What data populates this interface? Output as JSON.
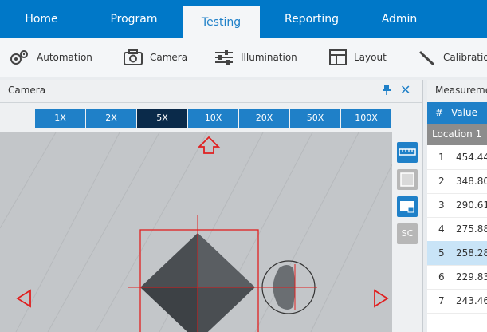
{
  "menu": {
    "tabs": [
      "Home",
      "Program",
      "Testing",
      "Reporting",
      "Admin"
    ],
    "active": "Testing"
  },
  "toolbar": {
    "items": [
      {
        "label": "Automation",
        "icon": "gears-icon"
      },
      {
        "label": "Camera",
        "icon": "camera-icon"
      },
      {
        "label": "Illumination",
        "icon": "sliders-icon"
      },
      {
        "label": "Layout",
        "icon": "layout-icon"
      },
      {
        "label": "Calibratio",
        "icon": "wrench-icon"
      }
    ]
  },
  "camera_panel": {
    "title": "Camera",
    "zoom_levels": [
      "1X",
      "2X",
      "5X",
      "10X",
      "20X",
      "50X",
      "100X"
    ],
    "active_zoom": "5X",
    "side_tools": [
      {
        "icon": "ruler-icon"
      },
      {
        "icon": "crop-icon"
      },
      {
        "icon": "monitor-icon"
      },
      {
        "icon": "sc-button",
        "label": "SC"
      }
    ]
  },
  "measurement_panel": {
    "title": "Measureme",
    "columns": [
      "#",
      "Value"
    ],
    "group_label": "Location 1",
    "rows": [
      {
        "n": "1",
        "v": "454.44"
      },
      {
        "n": "2",
        "v": "348.80"
      },
      {
        "n": "3",
        "v": "290.61"
      },
      {
        "n": "4",
        "v": "275.88"
      },
      {
        "n": "5",
        "v": "258.28"
      },
      {
        "n": "6",
        "v": "229.83"
      },
      {
        "n": "7",
        "v": "243.46"
      }
    ],
    "selected_row": "5"
  },
  "colors": {
    "accent": "#1f80c8",
    "menubar": "#0078c8",
    "overlay_red": "#e02020"
  }
}
